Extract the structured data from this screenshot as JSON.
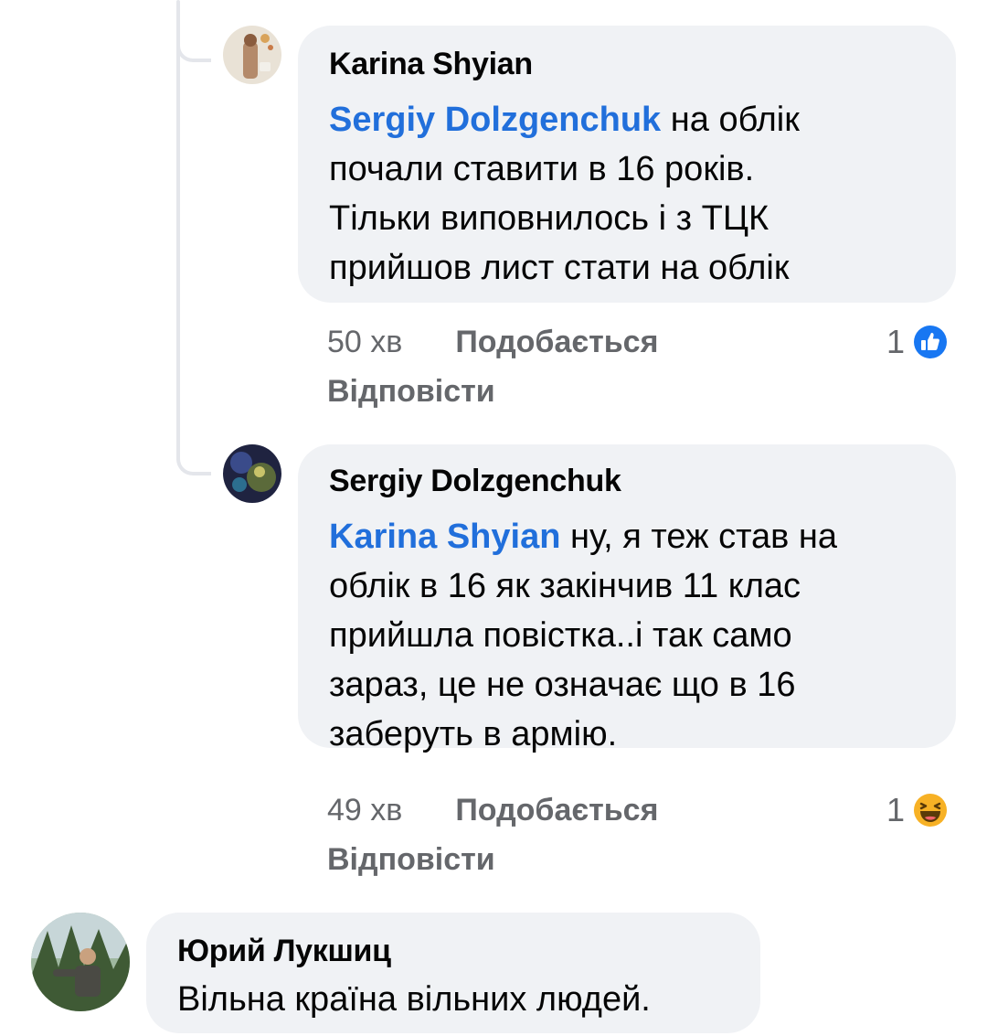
{
  "comments": [
    {
      "author": "Karina Shyian",
      "mention": "Sergiy Dolzgenchuk",
      "lines": [
        " на облік",
        "почали ставити в 16 років.",
        "Тільки виповнилось і з ТЦК",
        "прийшов лист стати на облік"
      ],
      "time": "50 хв",
      "like_label": "Подобається",
      "reply_label": "Відповісти",
      "reaction_count": "1",
      "reaction_icon": "like-reaction-icon"
    },
    {
      "author": "Sergiy Dolzgenchuk",
      "mention": "Karina Shyian",
      "lines": [
        " ну, я теж став на",
        "облік в 16 як закінчив 11 клас",
        "прийшла повістка..і так само",
        "зараз, це не означає що в 16",
        "заберуть в армію."
      ],
      "time": "49 хв",
      "like_label": "Подобається",
      "reply_label": "Відповісти",
      "reaction_count": "1",
      "reaction_icon": "haha-reaction-icon"
    },
    {
      "author": "Юрий Лукшиц",
      "text": "Вільна країна вільних людей."
    }
  ],
  "colors": {
    "bubble": "#f0f2f5",
    "mention": "#216fdb",
    "meta": "#65676b",
    "like_blue": "#1877f2",
    "haha_yellow": "#f7b125"
  }
}
